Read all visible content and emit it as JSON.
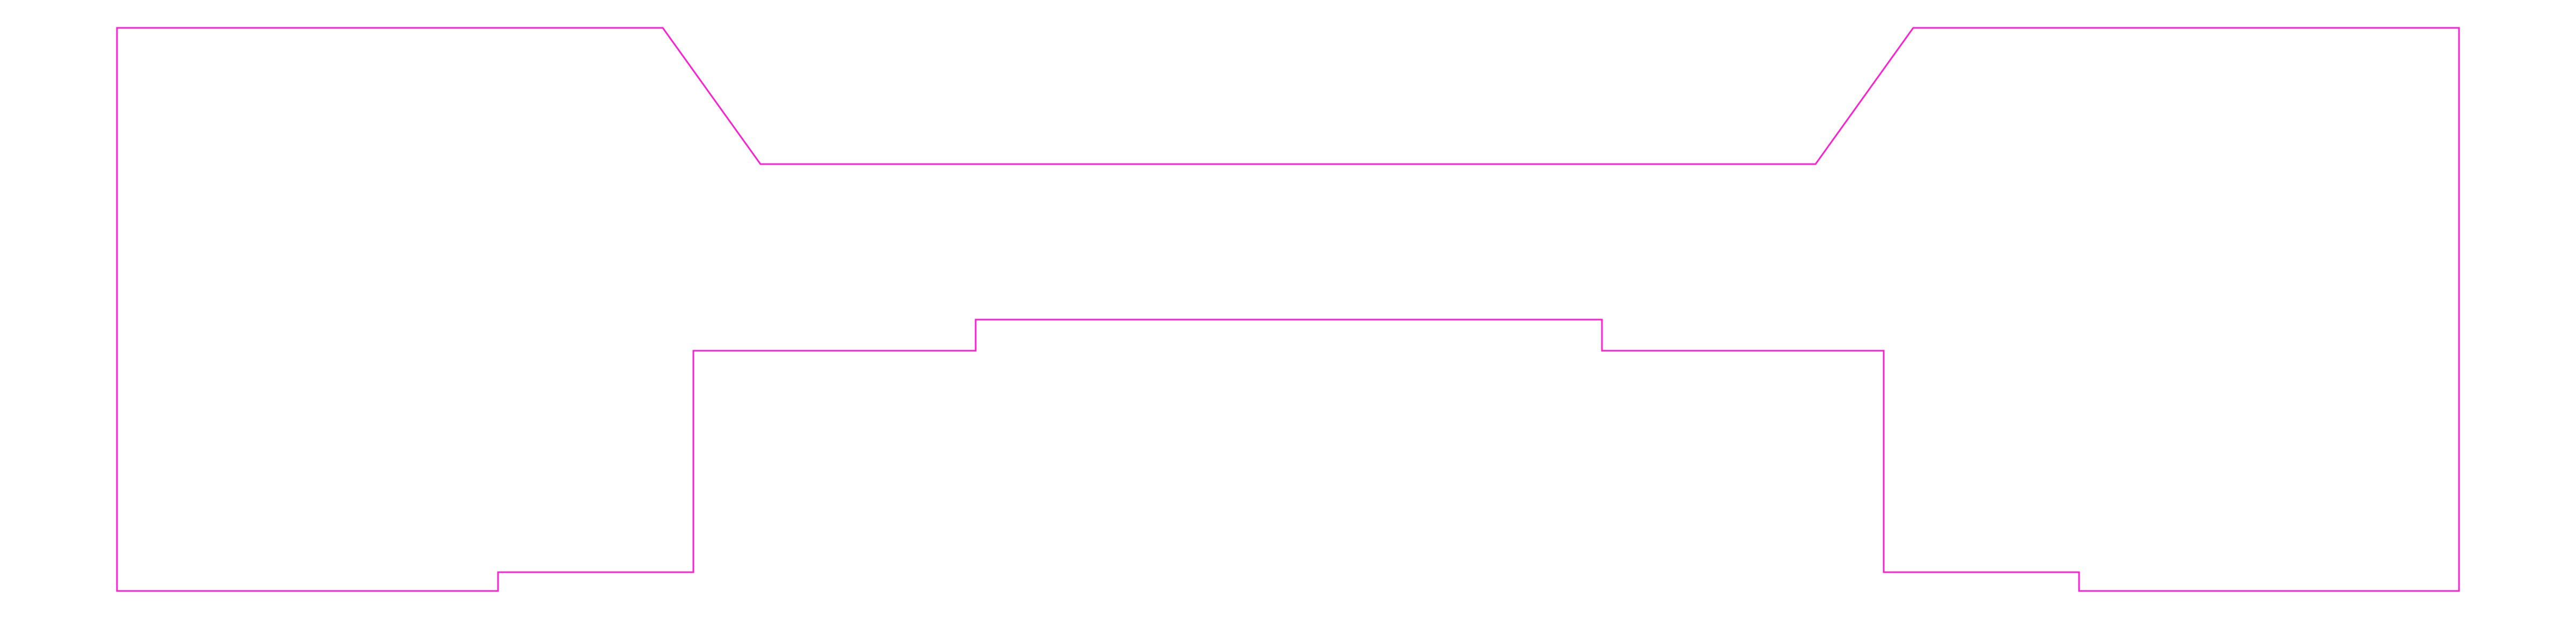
{
  "diagram": {
    "background_color": "#ffffff",
    "outline_color": "#ff1fd2",
    "shape": "closed-polyline-outline"
  }
}
